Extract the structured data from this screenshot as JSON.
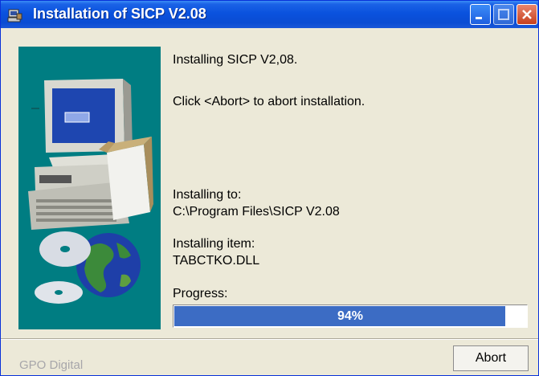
{
  "window": {
    "title": "Installation of SICP V2.08"
  },
  "messages": {
    "installing": "Installing SICP V2,08.",
    "abort_hint": "Click <Abort> to abort installation.",
    "installing_to_label": "Installing to:",
    "installing_to_value": "C:\\Program Files\\SICP V2.08",
    "installing_item_label": "Installing item:",
    "installing_item_value": "TABCTKO.DLL",
    "progress_label": "Progress:"
  },
  "progress": {
    "value": 94,
    "text": "94%",
    "color": "#3C6CC4"
  },
  "footer": {
    "brand": "GPO Digital",
    "abort_label": "Abort"
  },
  "icons": [
    "installer-app-icon",
    "minimize-icon",
    "maximize-icon",
    "close-icon",
    "computer-install-illustration"
  ]
}
